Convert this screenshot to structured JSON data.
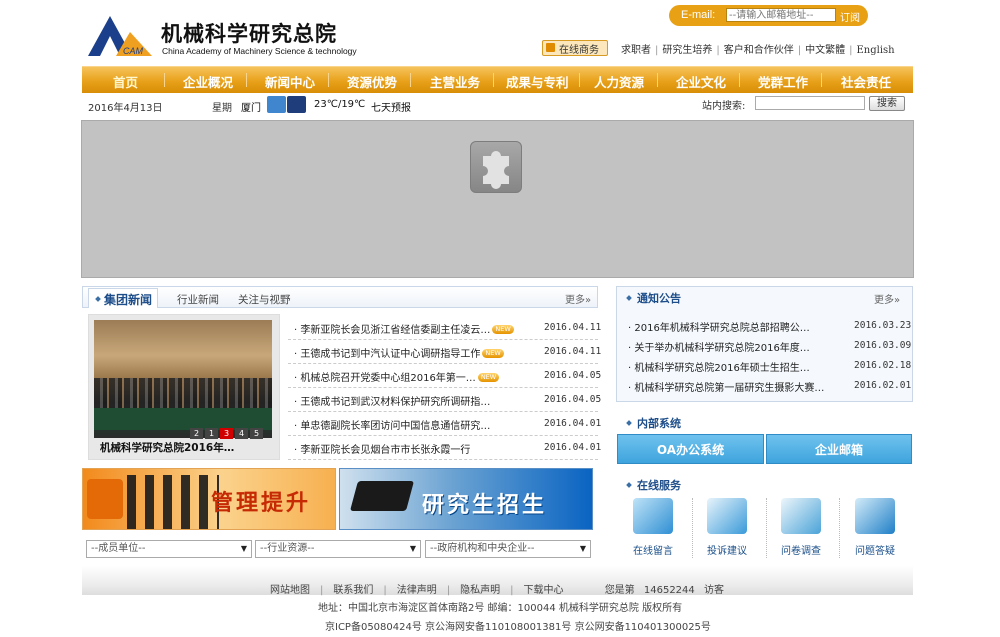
{
  "header": {
    "logo_cn": "机械科学研究总院",
    "logo_en": "China Academy of Machinery Science & technology",
    "logo_mark_text": "CAM",
    "email_label": "E-mail:",
    "email_placeholder": "--请输入邮箱地址--",
    "subscribe_label": "订阅",
    "online_business": "在线商务",
    "top_links": [
      "求职者",
      "研究生培养",
      "客户和合作伙伴",
      "中文繁體",
      "English"
    ]
  },
  "nav": {
    "items": [
      "首页",
      "企业概况",
      "新闻中心",
      "资源优势",
      "主营业务",
      "成果与专利",
      "人力资源",
      "企业文化",
      "党群工作",
      "社会责任"
    ]
  },
  "info_bar": {
    "date": "2016年4月13日",
    "week": "星期",
    "city": "厦门",
    "temp": "23℃/19℃",
    "forecast": "七天预报",
    "search_label": "站内搜索:",
    "search_button": "搜索"
  },
  "news": {
    "tabs": [
      "集团新闻",
      "行业新闻",
      "关注与视野"
    ],
    "more": "更多",
    "photo_caption": "机械科学研究总院2016年…",
    "pager": [
      "1",
      "2",
      "3",
      "4",
      "5"
    ],
    "pager_active": 3,
    "items": [
      {
        "title": "李新亚院长会见浙江省经信委副主任凌云…",
        "date": "2016.04.11",
        "new": true
      },
      {
        "title": "王德成书记到中汽认证中心调研指导工作",
        "date": "2016.04.11",
        "new": true
      },
      {
        "title": "机械总院召开党委中心组2016年第一…",
        "date": "2016.04.05",
        "new": true
      },
      {
        "title": "王德成书记到武汉材料保护研究所调研指…",
        "date": "2016.04.05",
        "new": false
      },
      {
        "title": "单忠德副院长率团访问中国信息通信研究…",
        "date": "2016.04.01",
        "new": false
      },
      {
        "title": "李新亚院长会见烟台市市长张永霞一行",
        "date": "2016.04.01",
        "new": false
      }
    ],
    "new_badge": "NEW"
  },
  "notice": {
    "title": "通知公告",
    "more": "更多",
    "items": [
      {
        "title": "2016年机械科学研究总院总部招聘公…",
        "date": "2016.03.23"
      },
      {
        "title": "关于举办机械科学研究总院2016年度…",
        "date": "2016.03.09"
      },
      {
        "title": "机械科学研究总院2016年硕士生招生…",
        "date": "2016.02.18"
      },
      {
        "title": "机械科学研究总院第一届研究生摄影大赛…",
        "date": "2016.02.01"
      }
    ]
  },
  "internal": {
    "title": "内部系统",
    "oa": "OA办公系统",
    "mail": "企业邮箱"
  },
  "services": {
    "title": "在线服务",
    "items": [
      "在线留言",
      "投诉建议",
      "问卷调查",
      "问题答疑"
    ]
  },
  "promos": {
    "management": "管理提升",
    "graduate": "研究生招生"
  },
  "selects": [
    "--成员单位--",
    "--行业资源--",
    "--政府机构和中央企业--"
  ],
  "footer": {
    "links": [
      "网站地图",
      "联系我们",
      "法律声明",
      "隐私声明",
      "下载中心"
    ],
    "visitor_prefix": "您是第",
    "visitor_count": "14652244",
    "visitor_suffix": "访客",
    "address": "地址：中国北京市海淀区首体南路2号  邮编：100044  机械科学研究总院  版权所有",
    "icp": "京ICP备05080424号  京公海网安备110108001381号  京公网安备110401300025号"
  },
  "colors": {
    "nav_orange": "#e8a11a",
    "accent_blue": "#1e4e8a",
    "oa_blue": "#3ea4dd"
  }
}
